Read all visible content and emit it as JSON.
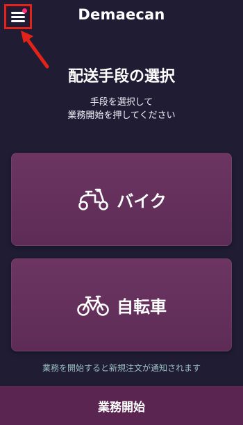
{
  "header": {
    "logo": "Demaecan",
    "menu_icon": "hamburger-menu-icon",
    "notification_dot_color": "#ff2f77",
    "highlight_color": "#e2231a"
  },
  "main": {
    "title": "配送手段の選択",
    "subtitle_lines": [
      "手段を選択して",
      "業務開始を押してください"
    ],
    "options": [
      {
        "label": "バイク",
        "icon": "scooter-icon"
      },
      {
        "label": "自転車",
        "icon": "bicycle-icon"
      }
    ],
    "notice": "業務を開始すると新規注文が通知されます"
  },
  "footer": {
    "start_label": "業務開始"
  },
  "colors": {
    "background": "#1f1c34",
    "card": "#6c3562",
    "button": "#5b2552",
    "notice_text": "#9cc0c4"
  }
}
